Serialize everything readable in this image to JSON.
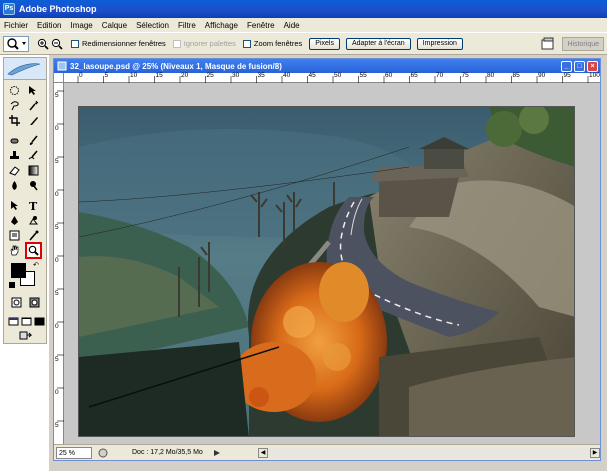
{
  "app": {
    "title": "Adobe Photoshop",
    "logo": "Ps"
  },
  "menu": [
    "Fichier",
    "Edition",
    "Image",
    "Calque",
    "Sélection",
    "Filtre",
    "Affichage",
    "Fenêtre",
    "Aide"
  ],
  "options": {
    "checkboxes": [
      {
        "label": "Redimensionner fenêtres",
        "checked": false,
        "disabled": false
      },
      {
        "label": "Ignorer palettes",
        "checked": false,
        "disabled": true
      },
      {
        "label": "Zoom fenêtres",
        "checked": false,
        "disabled": false
      }
    ],
    "buttons": [
      "Pixels",
      "Adapter à l'écran",
      "Impression"
    ],
    "history_tab": "Historique"
  },
  "document": {
    "title": "32_lasoupe.psd @ 25% (Niveaux 1, Masque de fusion/8)",
    "ruler_h": [
      "0",
      "5",
      "10",
      "15",
      "20",
      "25",
      "30",
      "35",
      "40",
      "45",
      "50",
      "55",
      "60",
      "65",
      "70",
      "75",
      "80",
      "85",
      "90",
      "95",
      "100"
    ],
    "ruler_v": [
      "5",
      "0",
      "5",
      "0",
      "5",
      "0",
      "5",
      "0",
      "5",
      "0",
      "5"
    ]
  },
  "status": {
    "zoom": "25 %",
    "doc": "Doc : 17,2 Mo/35,5 Mo"
  },
  "colors": {
    "foreground": "#000000",
    "background": "#ffffff",
    "highlight": "#e00000",
    "titlebar": "#0a5fd8"
  }
}
